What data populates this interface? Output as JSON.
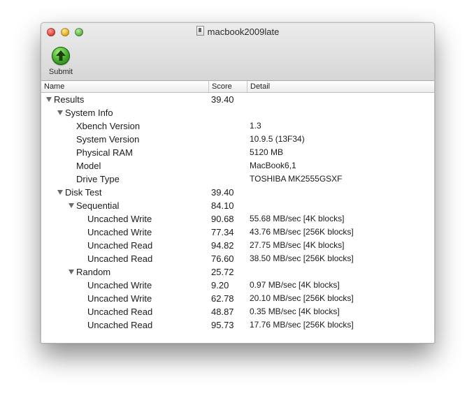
{
  "window": {
    "title": "macbook2009late"
  },
  "toolbar": {
    "submit_label": "Submit"
  },
  "columns": {
    "name": "Name",
    "score": "Score",
    "detail": "Detail"
  },
  "rows": {
    "results": {
      "name": "Results",
      "score": "39.40",
      "detail": ""
    },
    "system_info": {
      "name": "System Info",
      "score": "",
      "detail": ""
    },
    "xbench_version": {
      "name": "Xbench Version",
      "score": "",
      "detail": "1.3"
    },
    "system_version": {
      "name": "System Version",
      "score": "",
      "detail": "10.9.5 (13F34)"
    },
    "physical_ram": {
      "name": "Physical RAM",
      "score": "",
      "detail": "5120 MB"
    },
    "model": {
      "name": "Model",
      "score": "",
      "detail": "MacBook6,1"
    },
    "drive_type": {
      "name": "Drive Type",
      "score": "",
      "detail": "TOSHIBA MK2555GSXF"
    },
    "disk_test": {
      "name": "Disk Test",
      "score": "39.40",
      "detail": ""
    },
    "sequential": {
      "name": "Sequential",
      "score": "84.10",
      "detail": ""
    },
    "seq_write_4k": {
      "name": "Uncached Write",
      "score": "90.68",
      "detail": "55.68 MB/sec [4K blocks]"
    },
    "seq_write_256k": {
      "name": "Uncached Write",
      "score": "77.34",
      "detail": "43.76 MB/sec [256K blocks]"
    },
    "seq_read_4k": {
      "name": "Uncached Read",
      "score": "94.82",
      "detail": "27.75 MB/sec [4K blocks]"
    },
    "seq_read_256k": {
      "name": "Uncached Read",
      "score": "76.60",
      "detail": "38.50 MB/sec [256K blocks]"
    },
    "random": {
      "name": "Random",
      "score": "25.72",
      "detail": ""
    },
    "rnd_write_4k": {
      "name": "Uncached Write",
      "score": "9.20",
      "detail": "0.97 MB/sec [4K blocks]"
    },
    "rnd_write_256k": {
      "name": "Uncached Write",
      "score": "62.78",
      "detail": "20.10 MB/sec [256K blocks]"
    },
    "rnd_read_4k": {
      "name": "Uncached Read",
      "score": "48.87",
      "detail": "0.35 MB/sec [4K blocks]"
    },
    "rnd_read_256k": {
      "name": "Uncached Read",
      "score": "95.73",
      "detail": "17.76 MB/sec [256K blocks]"
    }
  },
  "icons": {
    "submit": "upload-arrow-icon",
    "disclosure": "disclosure-triangle-icon",
    "document": "document-icon"
  },
  "colors": {
    "submit_green": "#3fa626",
    "close": "#e0443e",
    "minimize": "#e4a923",
    "zoom": "#5db14a"
  }
}
